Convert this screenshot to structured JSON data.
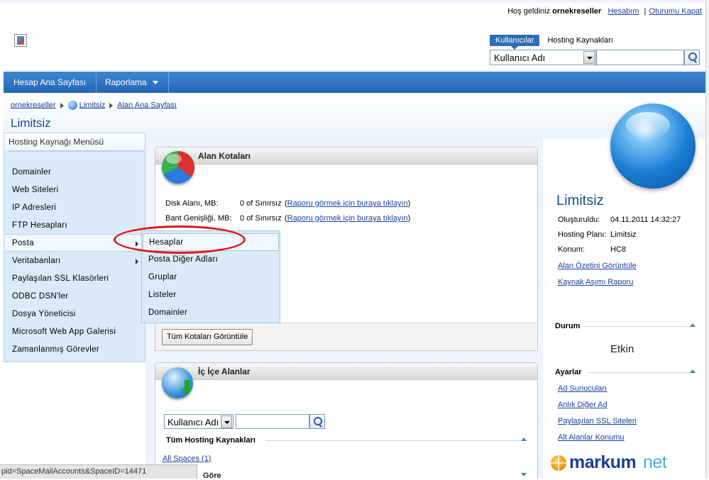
{
  "header": {
    "welcome_prefix": "Hoş geldiniz",
    "username": "ornekreseller",
    "account_link": "Hesabım",
    "separator": "|",
    "logout_link": "Oturumu Kapat"
  },
  "search": {
    "tabs": [
      "Kullanıcılar",
      "Hosting Kaynakları"
    ],
    "active_tab": "Kullanıcılar",
    "select_value": "Kullanıcı Adı",
    "input_value": ""
  },
  "nav": {
    "items": [
      {
        "label": "Hesap Ana Sayfası",
        "has_dropdown": false
      },
      {
        "label": "Raporlama",
        "has_dropdown": true
      }
    ]
  },
  "breadcrumb": [
    "ornekreseller",
    "Limitsiz",
    "Alan Ana Sayfası"
  ],
  "page_title": "Limitsiz",
  "left_menu": {
    "title": "Hosting Kaynağı Menüsü",
    "items": [
      {
        "label": "Domainler",
        "submenu": false
      },
      {
        "label": "Web Siteleri",
        "submenu": false
      },
      {
        "label": "IP Adresleri",
        "submenu": false
      },
      {
        "label": "FTP Hesapları",
        "submenu": false
      },
      {
        "label": "Posta",
        "submenu": true,
        "active": true
      },
      {
        "label": "Veritabanları",
        "submenu": true
      },
      {
        "label": "Paylaşılan SSL Klasörleri",
        "submenu": false
      },
      {
        "label": "ODBC DSN'ler",
        "submenu": false
      },
      {
        "label": "Dosya Yöneticisi",
        "submenu": false
      },
      {
        "label": "Microsoft Web App Galerisi",
        "submenu": false
      },
      {
        "label": "Zamanlanmış Görevler",
        "submenu": false
      }
    ]
  },
  "posta_submenu": {
    "items": [
      "Hesaplar",
      "Posta Diğer Adları",
      "Gruplar",
      "Listeler",
      "Domainler"
    ],
    "highlighted": "Hesaplar"
  },
  "quota_panel": {
    "title": "Alan Kotaları",
    "rows": [
      {
        "label": "Disk Alanı, MB:",
        "value": "0 of Sınırsız",
        "open_paren": "(",
        "link": "Raporu görmek için buraya tıklayın",
        "close_paren": ")"
      },
      {
        "label": "Bant Genişliği, MB:",
        "value": "0 of Sınırsız",
        "open_paren": "(",
        "link": "Raporu görmek için buraya tıklayın",
        "close_paren": ")"
      }
    ],
    "all_quotas_button": "Tüm Kotaları Görüntüle"
  },
  "nested_panel": {
    "title": "İç İçe Alanlar",
    "select_value": "Kullanıcı Adı",
    "input_value": "",
    "section_title": "Tüm Hosting Kaynakları",
    "all_spaces_link": "All Spaces (1)",
    "clipped_text": "Göre"
  },
  "summary": {
    "title": "Limitsiz",
    "fields": [
      {
        "label": "Oluşturuldu:",
        "value": "04.11.2011 14:32:27"
      },
      {
        "label": "Hosting Planı:",
        "value": "Limitsiz"
      },
      {
        "label": "Konum:",
        "value": "HC8"
      }
    ],
    "links": [
      "Alan Özetini Görüntüle",
      "Kaynak Aşımı Raporu"
    ]
  },
  "status_section": {
    "title": "Durum",
    "value": "Etkin"
  },
  "settings_section": {
    "title": "Ayarlar",
    "links": [
      "Ad Sunucuları",
      "Anlık Diğer Ad",
      "Paylaşılan SSL Siteleri",
      "Alt Alanlar Konumu"
    ]
  },
  "brand": {
    "part1": "markum",
    "part2": "net"
  },
  "status_bar_text": "pid=SpaceMailAccounts&SpaceID=14471",
  "colors": {
    "accent_blue": "#2466b5",
    "link": "#1a3f99",
    "highlight_ellipse": "#e01818",
    "brand_orange": "#f19a0b"
  }
}
